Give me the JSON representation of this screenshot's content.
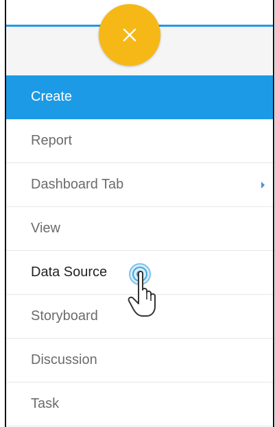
{
  "header": {
    "close_icon": "close-icon",
    "fab_color": "#f6b816",
    "accent_color": "#1c9ae6"
  },
  "menu": {
    "items": [
      {
        "label": "Create",
        "state": "active"
      },
      {
        "label": "Report"
      },
      {
        "label": "Dashboard Tab",
        "has_submenu": true,
        "submenu_icon": "chevron-right-icon"
      },
      {
        "label": "View"
      },
      {
        "label": "Data Source",
        "state": "hovered"
      },
      {
        "label": "Storyboard"
      },
      {
        "label": "Discussion"
      },
      {
        "label": "Task"
      }
    ]
  },
  "cursor": {
    "icon": "hand-pointer-icon"
  }
}
